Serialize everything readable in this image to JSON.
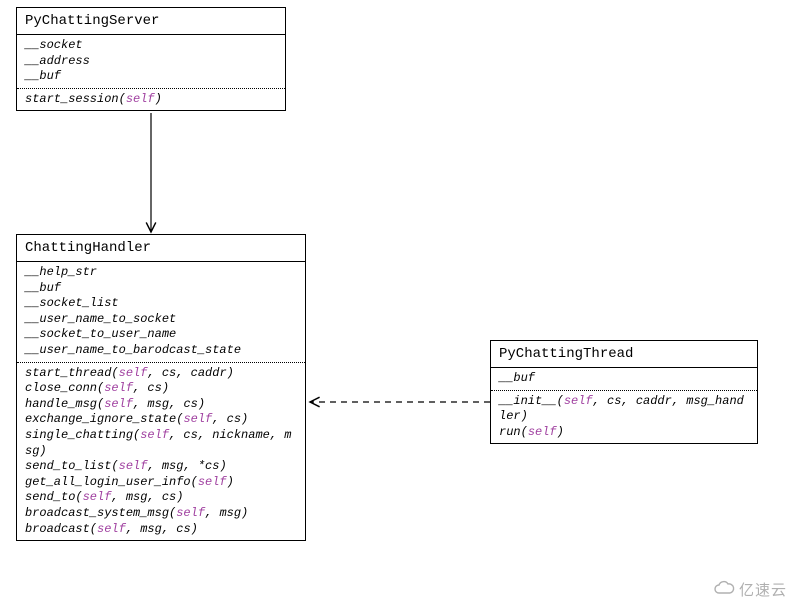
{
  "classes": {
    "server": {
      "name": "PyChattingServer",
      "attrs": [
        "__socket",
        "__address",
        "__buf"
      ],
      "methods": [
        "start_session(self)"
      ]
    },
    "handler": {
      "name": "ChattingHandler",
      "attrs": [
        "__help_str",
        "__buf",
        "__socket_list",
        "__user_name_to_socket",
        "__socket_to_user_name",
        "__user_name_to_barodcast_state"
      ],
      "methods": [
        "start_thread(self, cs, caddr)",
        "close_conn(self, cs)",
        "handle_msg(self, msg, cs)",
        "exchange_ignore_state(self, cs)",
        "single_chatting(self, cs, nickname, msg)",
        "send_to_list(self, msg, *cs)",
        "get_all_login_user_info(self)",
        "send_to(self, msg, cs)",
        "broadcast_system_msg(self, msg)",
        "broadcast(self, msg, cs)"
      ]
    },
    "thread": {
      "name": "PyChattingThread",
      "attrs": [
        "__buf"
      ],
      "methods": [
        "__init__(self, cs, caddr, msg_handler)",
        "run(self)"
      ]
    }
  },
  "watermark_text": "亿速云",
  "chart_data": {
    "type": "uml_class_diagram",
    "classes": [
      {
        "name": "PyChattingServer",
        "attributes": [
          "__socket",
          "__address",
          "__buf"
        ],
        "operations": [
          "start_session(self)"
        ]
      },
      {
        "name": "ChattingHandler",
        "attributes": [
          "__help_str",
          "__buf",
          "__socket_list",
          "__user_name_to_socket",
          "__socket_to_user_name",
          "__user_name_to_barodcast_state"
        ],
        "operations": [
          "start_thread(self, cs, caddr)",
          "close_conn(self, cs)",
          "handle_msg(self, msg, cs)",
          "exchange_ignore_state(self, cs)",
          "single_chatting(self, cs, nickname, msg)",
          "send_to_list(self, msg, *cs)",
          "get_all_login_user_info(self)",
          "send_to(self, msg, cs)",
          "broadcast_system_msg(self, msg)",
          "broadcast(self, msg, cs)"
        ]
      },
      {
        "name": "PyChattingThread",
        "attributes": [
          "__buf"
        ],
        "operations": [
          "__init__(self, cs, caddr, msg_handler)",
          "run(self)"
        ]
      }
    ],
    "relationships": [
      {
        "from": "PyChattingServer",
        "to": "ChattingHandler",
        "type": "association",
        "style": "solid",
        "arrow": "open"
      },
      {
        "from": "PyChattingThread",
        "to": "ChattingHandler",
        "type": "dependency",
        "style": "dashed",
        "arrow": "open"
      }
    ]
  }
}
